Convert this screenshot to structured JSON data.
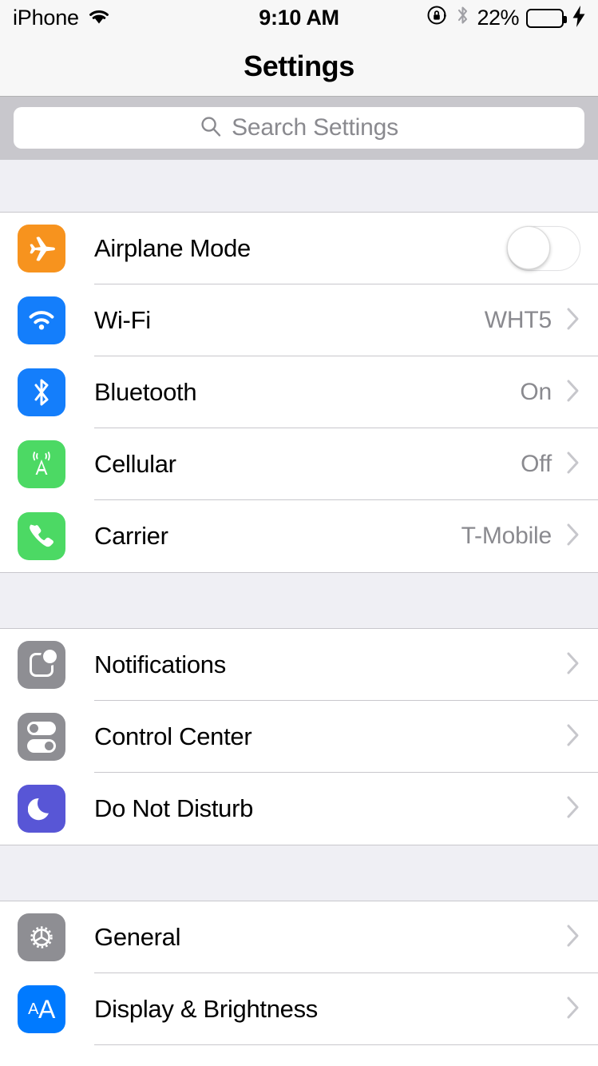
{
  "status_bar": {
    "carrier_label": "iPhone",
    "wifi_icon": "wifi-icon",
    "time": "9:10 AM",
    "rotation_lock_icon": "rotation-lock-icon",
    "bluetooth_icon": "bluetooth-icon",
    "battery_percent": "22%",
    "battery_level": 22,
    "charging_icon": "lightning-bolt-icon",
    "battery_fill_color": "#4cd964"
  },
  "nav": {
    "title": "Settings"
  },
  "search": {
    "icon": "search-icon",
    "placeholder": "Search Settings",
    "value": ""
  },
  "groups": [
    {
      "rows": [
        {
          "label": "Airplane Mode",
          "icon": "airplane-icon",
          "icon_color": "#f7931e",
          "accessory": "toggle",
          "toggle_on": false,
          "value": ""
        },
        {
          "label": "Wi-Fi",
          "icon": "wifi-icon",
          "icon_color": "#147efb",
          "accessory": "disclosure",
          "value": "WHT5"
        },
        {
          "label": "Bluetooth",
          "icon": "bluetooth-icon",
          "icon_color": "#147efb",
          "accessory": "disclosure",
          "value": "On"
        },
        {
          "label": "Cellular",
          "icon": "cell-tower-icon",
          "icon_color": "#4cd964",
          "accessory": "disclosure",
          "value": "Off"
        },
        {
          "label": "Carrier",
          "icon": "phone-handset-icon",
          "icon_color": "#4cd964",
          "accessory": "disclosure",
          "value": "T-Mobile"
        }
      ]
    },
    {
      "rows": [
        {
          "label": "Notifications",
          "icon": "notification-badge-icon",
          "icon_color": "#8e8e93",
          "accessory": "disclosure",
          "value": ""
        },
        {
          "label": "Control Center",
          "icon": "control-toggles-icon",
          "icon_color": "#8e8e93",
          "accessory": "disclosure",
          "value": ""
        },
        {
          "label": "Do Not Disturb",
          "icon": "crescent-moon-icon",
          "icon_color": "#5856d6",
          "accessory": "disclosure",
          "value": ""
        }
      ]
    },
    {
      "rows": [
        {
          "label": "General",
          "icon": "gear-icon",
          "icon_color": "#8e8e93",
          "accessory": "disclosure",
          "value": ""
        },
        {
          "label": "Display & Brightness",
          "icon": "text-size-aa-icon",
          "icon_color": "#007aff",
          "accessory": "disclosure",
          "value": ""
        }
      ]
    }
  ]
}
